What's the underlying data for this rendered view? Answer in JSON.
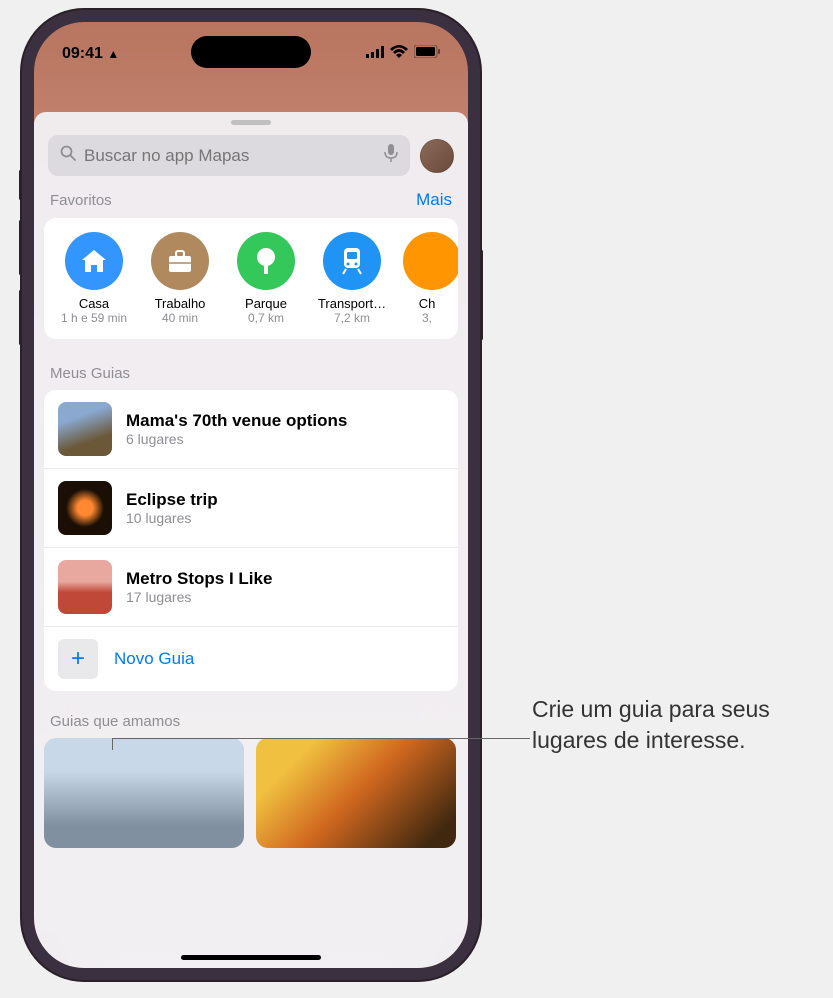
{
  "status": {
    "time": "09:41",
    "location_arrow": "➤"
  },
  "search": {
    "placeholder": "Buscar no app Mapas"
  },
  "favorites": {
    "header": "Favoritos",
    "more": "Mais",
    "items": [
      {
        "name": "Casa",
        "sub": "1 h e 59 min"
      },
      {
        "name": "Trabalho",
        "sub": "40 min"
      },
      {
        "name": "Parque",
        "sub": "0,7 km"
      },
      {
        "name": "Transport…",
        "sub": "7,2 km"
      },
      {
        "name": "Ch",
        "sub": "3,"
      }
    ]
  },
  "my_guides": {
    "header": "Meus Guias",
    "items": [
      {
        "title": "Mama's 70th venue options",
        "count": "6 lugares"
      },
      {
        "title": "Eclipse trip",
        "count": "10 lugares"
      },
      {
        "title": "Metro Stops I Like",
        "count": "17 lugares"
      }
    ],
    "new_guide": "Novo Guia"
  },
  "loved": {
    "header": "Guias que amamos"
  },
  "callout": {
    "text": "Crie um guia para seus lugares de interesse."
  }
}
